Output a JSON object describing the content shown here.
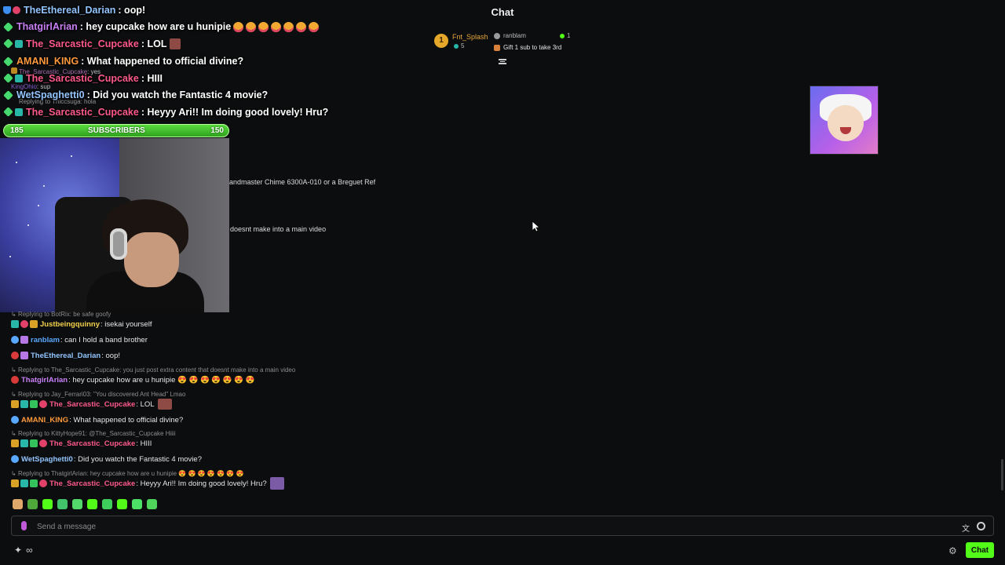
{
  "header": {
    "title": "Chat"
  },
  "pinned_gift": {
    "rank": "1",
    "gifter_name": "Fnt_Splash",
    "gifter_count": "5",
    "recipient_name": "ranblam",
    "recipient_count": "1",
    "message": "Gift 1 sub to take 3rd"
  },
  "overlay": {
    "lines": [
      {
        "user": "TheEthereal_Darian",
        "user_color": "#93c5ff",
        "text": ": oop!"
      },
      {
        "user": "ThatgirlArian",
        "user_color": "#c980f5",
        "text": ": hey cupcake how are u hunipie"
      },
      {
        "user": "The_Sarcastic_Cupcake",
        "user_color": "#ff5a8c",
        "text": ": LOL"
      },
      {
        "user": "AMANI_KING",
        "user_color": "#ff9a3c",
        "text": ": What happened to official divine?"
      },
      {
        "user": "The_Sarcastic_Cupcake",
        "user_color": "#ff5a8c",
        "text": ": HIII"
      },
      {
        "user": "WetSpaghetti0",
        "user_color": "#93c5ff",
        "text": ": Did you watch the Fantastic 4 movie?"
      },
      {
        "user": "The_Sarcastic_Cupcake",
        "user_color": "#ff5a8c",
        "text": ": Heyyy Ari!! Im doing good lovely! Hru?"
      }
    ],
    "ghost_lines": [
      {
        "user": "The_Sarcastic_Cupcake",
        "text": ": yes"
      },
      {
        "user": "KingOhio",
        "text": ": sup"
      },
      {
        "user": "Replying to Thiccsuga:",
        "text": " hola"
      }
    ],
    "sub_bar": {
      "left": "185",
      "label": "SUBSCRIBERS",
      "right": "150"
    }
  },
  "truncated": {
    "line1": "andmaster Chime 6300A-010 or a Breguet Ref",
    "line2": "doesnt make into a main video"
  },
  "chat": [
    {
      "type": "reply",
      "text": "Replying to BotRix: be safe goofy"
    },
    {
      "type": "msg",
      "user": "Justbeingquinny",
      "color": "#f2d14a",
      "text": ": isekai yourself",
      "badges": [
        "#33c25b",
        "#e2426a",
        "#d9a227"
      ]
    },
    {
      "type": "msg",
      "user": "ranblam",
      "color": "#5aa8ff",
      "text": ": can I hold a band brother",
      "badges": [
        "#5aa8ff",
        "#b678e6"
      ]
    },
    {
      "type": "msg",
      "user": "TheEthereal_Darian",
      "color": "#93c5ff",
      "text": ": oop!",
      "badges": [
        "#d93a3a",
        "#b678e6"
      ]
    },
    {
      "type": "reply",
      "text": "Replying to The_Sarcastic_Cupcake: you just post extra content that doesnt make into a main video"
    },
    {
      "type": "msg",
      "user": "ThatgirlArian",
      "color": "#c980f5",
      "text": ": hey cupcake how are u hunipie 😍 😍 😍 😍 😍 😍 😍",
      "badges": [
        "#d93a3a"
      ]
    },
    {
      "type": "reply",
      "text": "Replying to Jay_Ferrari03: \"You discovered Ant Head\" Lmao"
    },
    {
      "type": "msg",
      "user": "The_Sarcastic_Cupcake",
      "color": "#ff5a8c",
      "text": ": LOL",
      "badges": [
        "#d9a227",
        "#28b6a8",
        "#33c25b",
        "#e2426a"
      ]
    },
    {
      "type": "msg",
      "user": "AMANI_KING",
      "color": "#ff9a3c",
      "text": ": What happened to official divine?",
      "badges": [
        "#5aa8ff"
      ]
    },
    {
      "type": "reply",
      "text": "Replying to KittyHope91: @The_Sarcastic_Cupcake Hiiii"
    },
    {
      "type": "msg",
      "user": "The_Sarcastic_Cupcake",
      "color": "#ff5a8c",
      "text": ": HIII",
      "badges": [
        "#d9a227",
        "#28b6a8",
        "#33c25b",
        "#e2426a"
      ]
    },
    {
      "type": "msg",
      "user": "WetSpaghetti0",
      "color": "#93c5ff",
      "text": ": Did you watch the Fantastic 4 movie?",
      "badges": [
        "#5aa8ff"
      ]
    },
    {
      "type": "reply",
      "text": "Replying to ThatgirlArian: hey cupcake how are u hunipie 😍 😍 😍 😍 😍 😍 😍"
    },
    {
      "type": "msg",
      "user": "The_Sarcastic_Cupcake",
      "color": "#ff5a8c",
      "text": ": Heyyy Ari!! Im doing good lovely! Hru?",
      "badges": [
        "#d9a227",
        "#28b6a8",
        "#33c25b",
        "#e2426a"
      ]
    }
  ],
  "input": {
    "placeholder": "Send a message"
  },
  "footer": {
    "chat_button": "Chat",
    "left_icons": [
      "sparkle-icon",
      "infinity-icon"
    ]
  },
  "colors": {
    "accent": "#53fc18",
    "background": "#0b0d0e"
  }
}
